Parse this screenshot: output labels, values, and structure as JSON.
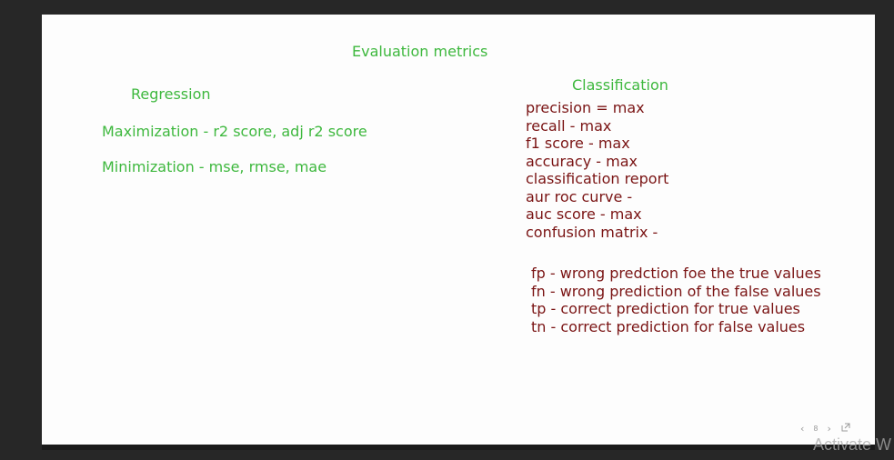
{
  "slide": {
    "title": "Evaluation metrics",
    "regression": {
      "heading": "Regression",
      "lines": [
        "Maximization - r2 score, adj r2 score",
        "Minimization - mse, rmse, mae"
      ]
    },
    "classification": {
      "heading": "Classification",
      "metrics": [
        "precision = max",
        "recall - max",
        "f1 score - max",
        "accuracy - max",
        "classification report",
        "aur roc curve -",
        "auc score - max",
        "confusion matrix -"
      ],
      "confusion_terms": [
        "fp - wrong predction foe the true values",
        "fn - wrong prediction of the false values",
        "tp - correct prediction for true values",
        "tn - correct prediction for false values"
      ]
    }
  },
  "controls": {
    "prev_icon": "chevron-left-icon",
    "page_number": "8",
    "next_icon": "chevron-right-icon",
    "fullscreen_icon": "expand-icon"
  },
  "watermark": "Activate W",
  "colors": {
    "heading_green": "#3eb83e",
    "text_maroon": "#7a1414",
    "background": "#272727",
    "slide": "#fdfdfd"
  }
}
